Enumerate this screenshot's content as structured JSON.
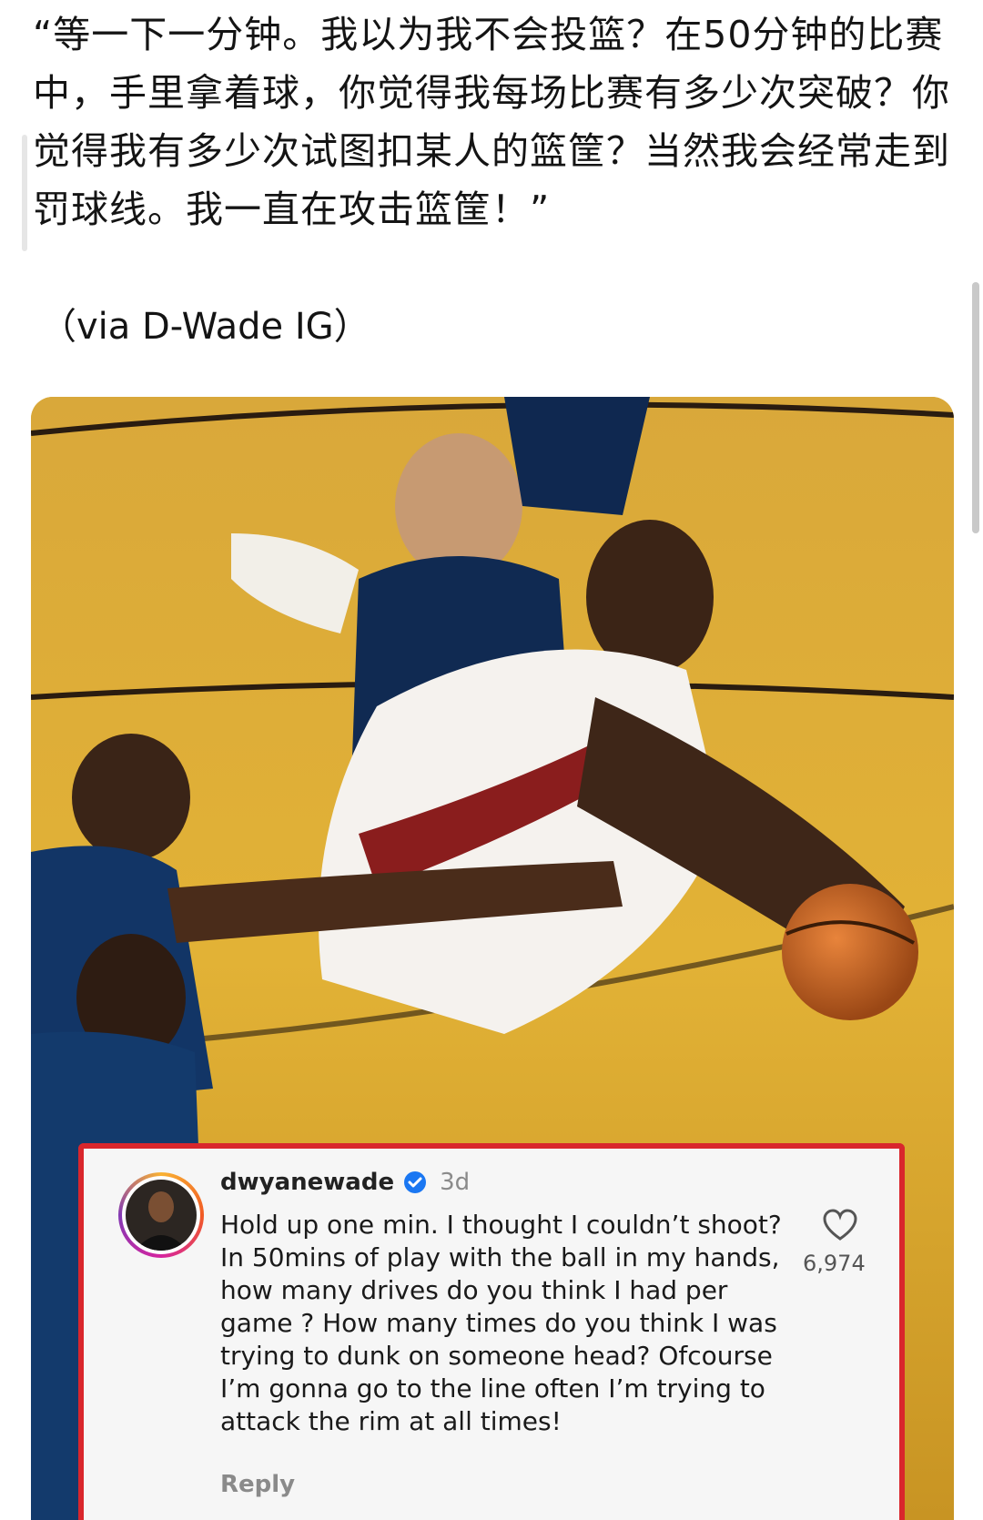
{
  "post": {
    "text": "“等一下一分钟。我以为我不会投篮？在50分钟的比赛中，手里拿着球，你觉得我每场比赛有多少次突破？你觉得我有多少次试图扣某人的篮筐？当然我会经常走到罚球线。我一直在攻击篮筐！”",
    "via": "（via D-Wade IG）"
  },
  "comment": {
    "username": "dwyanewade",
    "time": "3d",
    "text": "Hold up one min. I thought I couldn’t shoot? In 50mins of play with the ball in my hands, how many drives do you think I had per game ? How many times do you think I was trying to dunk on someone head? Ofcourse I’m gonna go to the line often I’m trying to attack the rim at all times!",
    "likes": "6,974",
    "reply_label": "Reply",
    "icons": {
      "verified": "verified-badge-icon",
      "like": "heart-icon"
    }
  },
  "colors": {
    "highlight_border": "#d9262c",
    "court": "#d6a02c",
    "verified": "#1a77f2"
  }
}
